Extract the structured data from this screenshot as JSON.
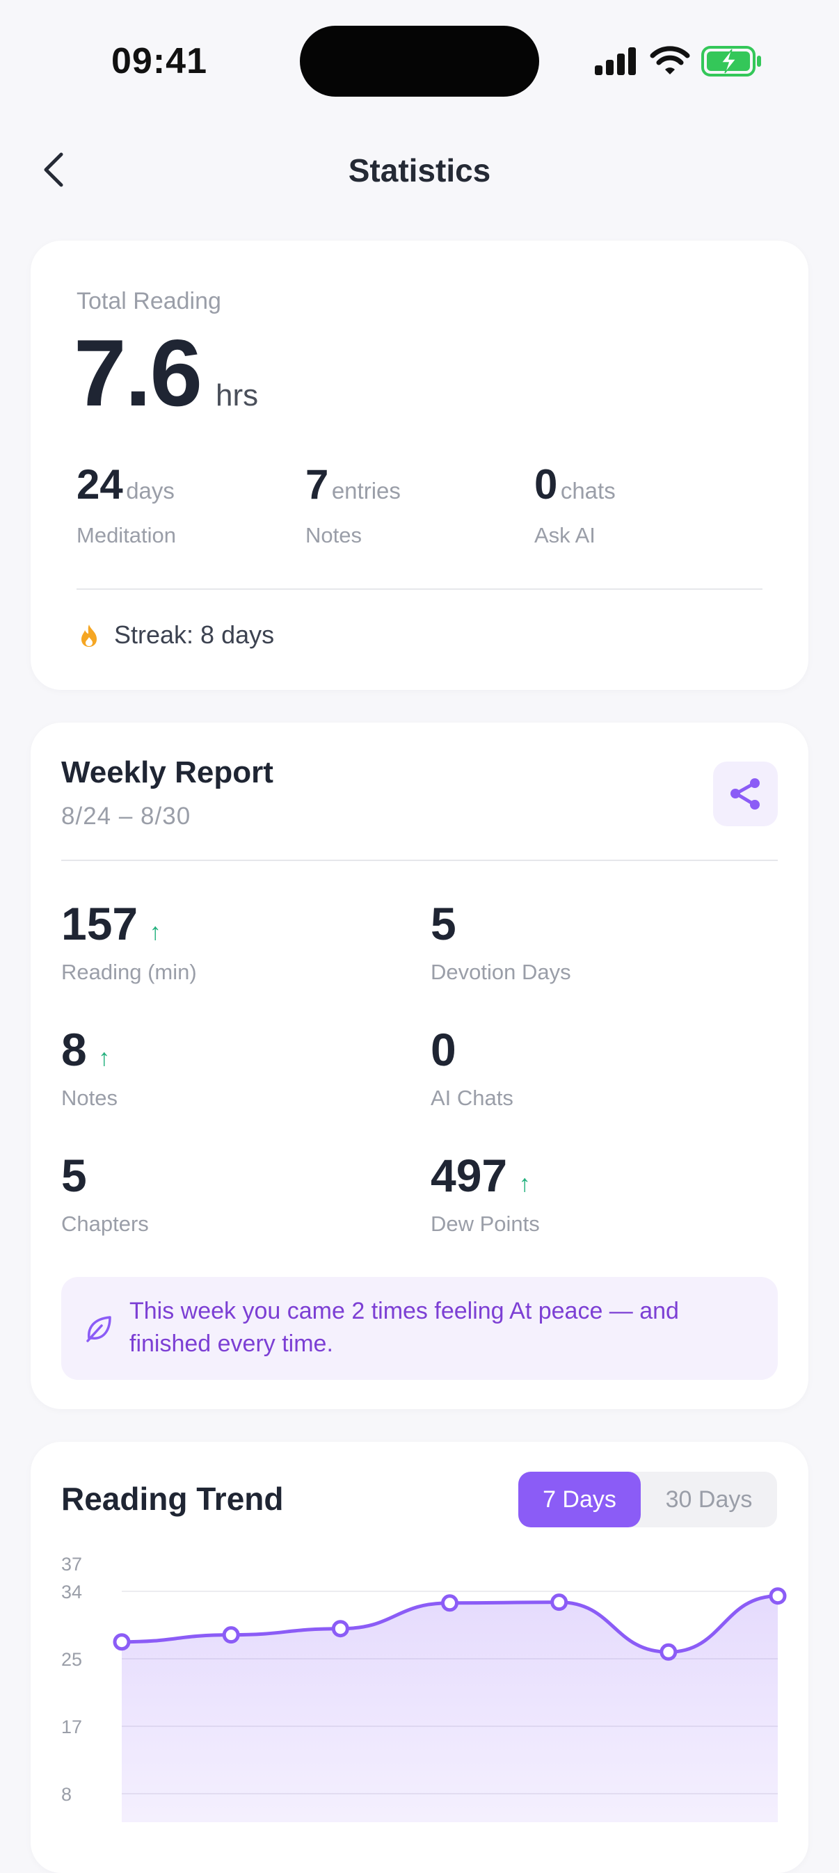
{
  "status": {
    "time": "09:41"
  },
  "header": {
    "title": "Statistics"
  },
  "total": {
    "label": "Total Reading",
    "value": "7.6",
    "unit": "hrs",
    "stats": [
      {
        "value": "24",
        "unit": "days",
        "label": "Meditation"
      },
      {
        "value": "7",
        "unit": "entries",
        "label": "Notes"
      },
      {
        "value": "0",
        "unit": "chats",
        "label": "Ask AI"
      }
    ],
    "streak": "Streak: 8 days"
  },
  "weekly": {
    "title": "Weekly Report",
    "date_range": "8/24 – 8/30",
    "metrics": [
      {
        "value": "157",
        "label": "Reading (min)",
        "trend": "up"
      },
      {
        "value": "5",
        "label": "Devotion Days",
        "trend": ""
      },
      {
        "value": "8",
        "label": "Notes",
        "trend": "up"
      },
      {
        "value": "0",
        "label": "AI Chats",
        "trend": ""
      },
      {
        "value": "5",
        "label": "Chapters",
        "trend": ""
      },
      {
        "value": "497",
        "label": "Dew Points",
        "trend": "up"
      }
    ],
    "insight": "This week you came 2 times feeling At peace — and finished every time."
  },
  "trend": {
    "title": "Reading Trend",
    "tabs": [
      "7 Days",
      "30 Days"
    ],
    "active_tab": "7 Days"
  },
  "colors": {
    "accent": "#8b5cf6",
    "up": "#22b07d",
    "streak": "#f5a623"
  },
  "chart_data": {
    "type": "area",
    "yticks": [
      "37",
      "34",
      "25",
      "17",
      "8"
    ],
    "ylim": [
      0,
      37
    ],
    "series": [
      {
        "values": [
          27.5,
          28.4,
          29.2,
          32.5,
          32.6,
          26.2,
          33.4
        ]
      }
    ]
  }
}
